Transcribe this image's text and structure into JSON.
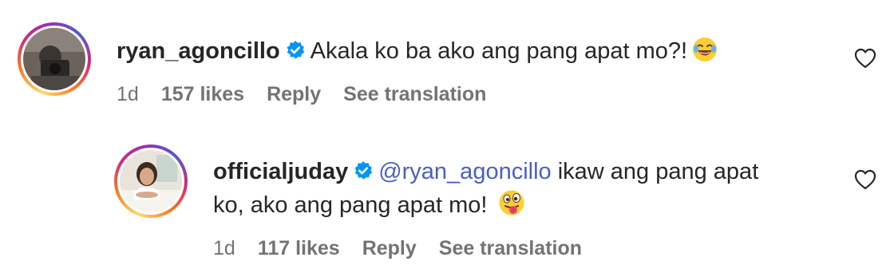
{
  "comments": [
    {
      "username": "ryan_agoncillo",
      "verified": true,
      "text": "Akala ko ba ako ang pang apat mo?!",
      "emoji": "face-with-tears-of-joy",
      "age": "1d",
      "likes": "157 likes",
      "reply_label": "Reply",
      "translation_label": "See translation"
    },
    {
      "username": "officialjuday",
      "verified": true,
      "mention": "@ryan_agoncillo",
      "text_line1": "ikaw ang pang apat",
      "text_line2": "ko, ako ang pang apat mo!",
      "emoji": "winking-face-with-tongue",
      "age": "1d",
      "likes": "117 likes",
      "reply_label": "Reply",
      "translation_label": "See translation"
    }
  ],
  "colors": {
    "username": "#262626",
    "mention": "#4a5fc1",
    "meta": "#737373",
    "verified": "#0095f6"
  }
}
